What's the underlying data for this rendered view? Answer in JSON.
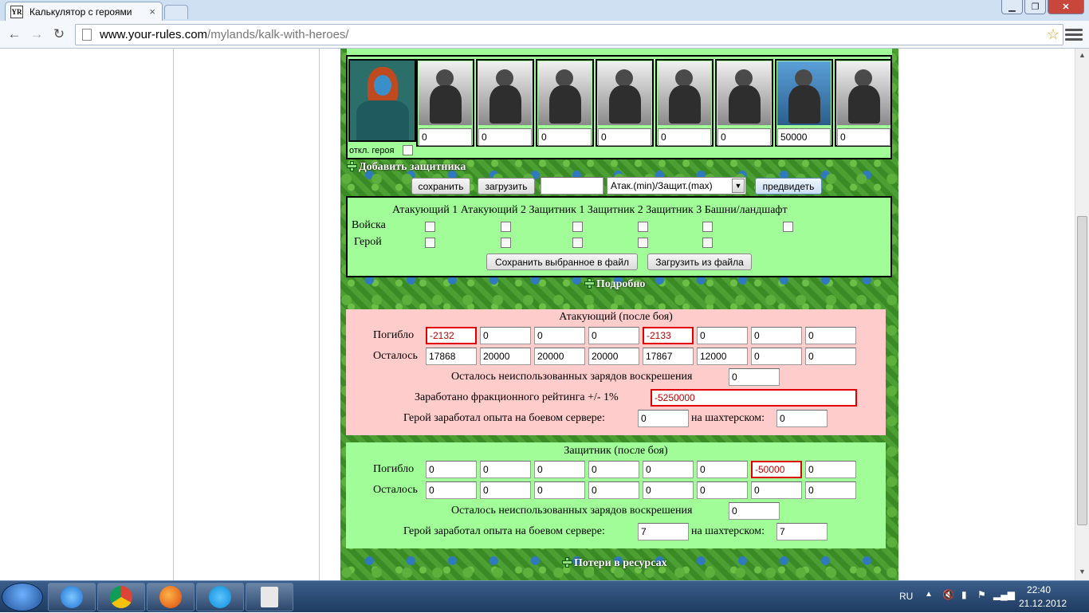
{
  "browser": {
    "tab_title": "Калькулятор с героями",
    "tab_favicon": "YR",
    "url_host": "www.your-rules.com",
    "url_path": "/mylands/kalk-with-heroes/"
  },
  "defender_units": {
    "hero_disable_label": "откл. героя",
    "values": [
      "0",
      "0",
      "0",
      "0",
      "0",
      "0",
      "50000",
      "0"
    ]
  },
  "add_defender_label": "Добавить защитника",
  "controls": {
    "save": "сохранить",
    "load": "загрузить",
    "name_value": "",
    "mode_select": "Атак.(min)/Защит.(max)",
    "predict": "предвидеть"
  },
  "save_panel": {
    "headers": "Атакующий 1 Атакующий 2 Защитник 1 Защитник 2 Защитник 3 Башни/ландшафт",
    "row_troops": "Войска",
    "row_hero": "Герой",
    "save_file": "Сохранить выбранное в файл",
    "load_file": "Загрузить из файла"
  },
  "details_label": "Подробно",
  "attacker": {
    "title": "Атакующий (после боя)",
    "lost_label": "Погибло",
    "left_label": "Осталось",
    "lost": [
      "-2132",
      "0",
      "0",
      "0",
      "-2133",
      "0",
      "0",
      "0"
    ],
    "left": [
      "17868",
      "20000",
      "20000",
      "20000",
      "17867",
      "12000",
      "0",
      "0"
    ],
    "resurrect_label": "Осталось неиспользованных зарядов воскрешения",
    "resurrect": "0",
    "rating_label": "Заработано фракционного рейтинга +/- 1%",
    "rating": "-5250000",
    "exp_label": "Герой заработал опыта на боевом сервере:",
    "exp_battle": "0",
    "mining_label": "на шахтерском:",
    "exp_mining": "0"
  },
  "defender": {
    "title": "Защитник (после боя)",
    "lost_label": "Погибло",
    "left_label": "Осталось",
    "lost": [
      "0",
      "0",
      "0",
      "0",
      "0",
      "0",
      "-50000",
      "0"
    ],
    "left": [
      "0",
      "0",
      "0",
      "0",
      "0",
      "0",
      "0",
      "0"
    ],
    "resurrect_label": "Осталось неиспользованных зарядов воскрешения",
    "resurrect": "0",
    "exp_label": "Герой заработал опыта на боевом сервере:",
    "exp_battle": "7",
    "mining_label": "на шахтерском:",
    "exp_mining": "7"
  },
  "resource_loss_label": "Потери в ресурсах",
  "taskbar": {
    "lang": "RU",
    "time": "22:40",
    "date": "21.12.2012"
  },
  "colors": {
    "panel_green": "#a0fd97",
    "panel_pink": "#ffcccc",
    "error_red": "#e10000"
  }
}
